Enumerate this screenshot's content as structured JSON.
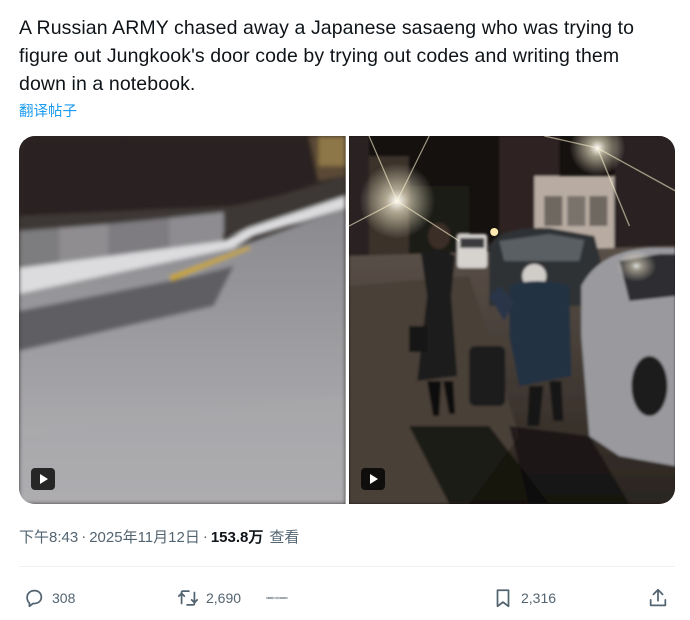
{
  "tweet": {
    "text": "A Russian ARMY chased away a Japanese sasaeng who was trying to figure out Jungkook's door code by trying out codes and writing them down in a notebook.",
    "translate_label": "翻译帖子"
  },
  "media": [
    {
      "type": "video",
      "description_icon": "play-icon"
    },
    {
      "type": "video",
      "description_icon": "play-icon"
    }
  ],
  "meta": {
    "time": "下午8:43",
    "separator": "·",
    "date": "2025年11月12日",
    "views_count": "153.8万",
    "views_label": "查看"
  },
  "actions": {
    "reply_count": "308",
    "retweet_count": "2,690",
    "bookmark_count": "2,316"
  },
  "colors": {
    "text": "#0f1419",
    "secondary": "#536471",
    "link": "#1d9bf0"
  }
}
